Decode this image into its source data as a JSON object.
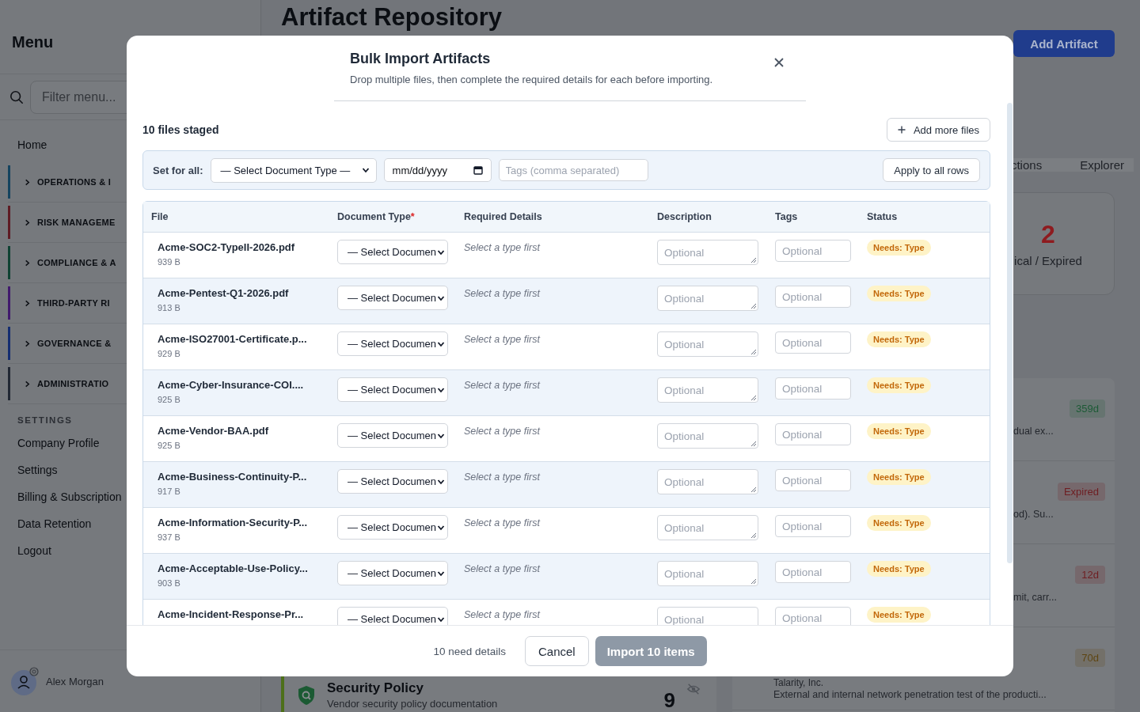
{
  "sidebar": {
    "title": "Menu",
    "filter_placeholder": "Filter menu...",
    "home": "Home",
    "sections": [
      {
        "label": "OPERATIONS & I",
        "color": "#15445f"
      },
      {
        "label": "RISK MANAGEME",
        "color": "#5e1c24"
      },
      {
        "label": "COMPLIANCE & A",
        "color": "#0f4233"
      },
      {
        "label": "THIRD-PARTY RI",
        "color": "#411a6d"
      },
      {
        "label": "GOVERNANCE &",
        "color": "#152e71"
      },
      {
        "label": "ADMINISTRATIO",
        "color": "#212834"
      }
    ],
    "settings_heading": "SETTINGS",
    "settings_items": [
      "Company Profile",
      "Settings",
      "Billing & Subscription",
      "Data Retention",
      "Logout"
    ],
    "user": "Alex Morgan"
  },
  "page": {
    "title": "Artifact Repository",
    "add_button": "Add Artifact",
    "tabs": [
      "ctions",
      "Explorer"
    ],
    "stat": {
      "value": "2",
      "label": "ical / Expired"
    },
    "list_rows": [
      {
        "badge": "359d",
        "color": "#1d5a36",
        "description": "dual ex..."
      },
      {
        "badge": "Expired",
        "color": "#6e1d21",
        "description": "od). Su..."
      },
      {
        "badge": "12d",
        "color": "#6e1d21",
        "description": "mit, carr..."
      },
      {
        "badge": "70d",
        "color": "#5e4512",
        "vendor": "Talarity, Inc.",
        "description": "External and internal network penetration test of the producti..."
      }
    ],
    "policy_card": {
      "title": "Security Policy",
      "description": "Vendor security policy documentation",
      "count": "9"
    }
  },
  "modal": {
    "title": "Bulk Import Artifacts",
    "subtitle": "Drop multiple files, then complete the required details for each before importing.",
    "staged": "10 files staged",
    "add_files": "Add more files",
    "set_all": {
      "label": "Set for all:",
      "type_select": "— Select Document Type —",
      "date_placeholder": "mm/dd/yyyy",
      "tags_placeholder": "Tags (comma separated)",
      "apply": "Apply to all rows"
    },
    "columns": [
      {
        "label": "File"
      },
      {
        "label": "Document Type",
        "required_mark": "*"
      },
      {
        "label": "Required Details"
      },
      {
        "label": "Description"
      },
      {
        "label": "Tags"
      },
      {
        "label": "Status"
      }
    ],
    "rows": [
      {
        "file": "Acme-SOC2-TypeII-2026.pdf",
        "size": "939 B",
        "document_type": "— Select Documen",
        "required": "Select a type first",
        "description_placeholder": "Optional",
        "tags_placeholder": "Optional",
        "status": "Needs: Type"
      },
      {
        "file": "Acme-Pentest-Q1-2026.pdf",
        "size": "913 B",
        "document_type": "— Select Documen",
        "required": "Select a type first",
        "description_placeholder": "Optional",
        "tags_placeholder": "Optional",
        "status": "Needs: Type"
      },
      {
        "file": "Acme-ISO27001-Certificate.p...",
        "size": "929 B",
        "document_type": "— Select Documen",
        "required": "Select a type first",
        "description_placeholder": "Optional",
        "tags_placeholder": "Optional",
        "status": "Needs: Type"
      },
      {
        "file": "Acme-Cyber-Insurance-COI....",
        "size": "925 B",
        "document_type": "— Select Documen",
        "required": "Select a type first",
        "description_placeholder": "Optional",
        "tags_placeholder": "Optional",
        "status": "Needs: Type"
      },
      {
        "file": "Acme-Vendor-BAA.pdf",
        "size": "925 B",
        "document_type": "— Select Documen",
        "required": "Select a type first",
        "description_placeholder": "Optional",
        "tags_placeholder": "Optional",
        "status": "Needs: Type"
      },
      {
        "file": "Acme-Business-Continuity-P...",
        "size": "917 B",
        "document_type": "— Select Documen",
        "required": "Select a type first",
        "description_placeholder": "Optional",
        "tags_placeholder": "Optional",
        "status": "Needs: Type"
      },
      {
        "file": "Acme-Information-Security-P...",
        "size": "937 B",
        "document_type": "— Select Documen",
        "required": "Select a type first",
        "description_placeholder": "Optional",
        "tags_placeholder": "Optional",
        "status": "Needs: Type"
      },
      {
        "file": "Acme-Acceptable-Use-Policy...",
        "size": "903 B",
        "document_type": "— Select Documen",
        "required": "Select a type first",
        "description_placeholder": "Optional",
        "tags_placeholder": "Optional",
        "status": "Needs: Type"
      },
      {
        "file": "Acme-Incident-Response-Pr...",
        "document_type": "— Select Documen",
        "required": "Select a type first",
        "description_placeholder": "Optional",
        "tags_placeholder": "Optional",
        "status": "Needs: Type"
      }
    ],
    "footer": {
      "summary": "10 need details",
      "cancel": "Cancel",
      "import_label": "Import 10 items",
      "import_disabled": true
    }
  }
}
